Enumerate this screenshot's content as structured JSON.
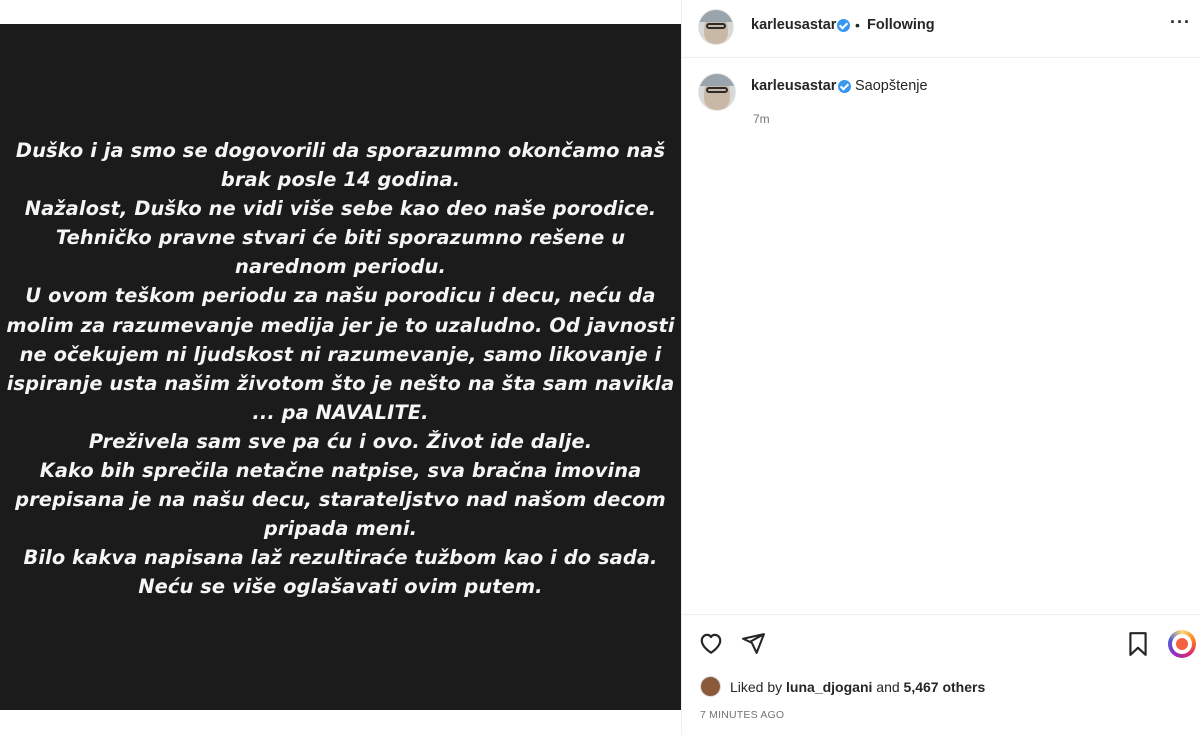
{
  "media": {
    "lines": [
      "Duško i ja smo se dogovorili da sporazumno okončamo naš",
      "brak posle 14 godina.",
      "Nažalost, Duško ne vidi više sebe kao deo naše porodice.",
      "Tehničko pravne stvari će biti sporazumno rešene u",
      "narednom periodu.",
      "U ovom teškom periodu za našu porodicu i decu, neću da",
      "molim za razumevanje medija jer je to uzaludno. Od javnosti",
      "ne očekujem ni ljudskost ni razumevanje, samo likovanje i",
      "ispiranje usta našim životom što je nešto na šta sam navikla",
      "... pa NAVALITE.",
      "Preživela sam sve pa ću i ovo. Život ide dalje.",
      "Kako bih sprečila netačne natpise, sva bračna imovina",
      "prepisana je na našu decu, starateljstvo nad našom decom",
      "pripada meni.",
      "Bilo kakva napisana laž rezultiraće tužbom kao i do sada.",
      "Neću se više oglašavati ovim putem."
    ]
  },
  "header": {
    "username": "karleusastar",
    "separator": "•",
    "follow_status": "Following",
    "more": "···"
  },
  "caption": {
    "username": "karleusastar",
    "text": "Saopštenje",
    "age": "7m"
  },
  "likes": {
    "prefix": "Liked by",
    "user": "luna_djogani",
    "and": "and",
    "others": "5,467 others"
  },
  "timestamp": "7 MINUTES AGO",
  "icons": {
    "verified": "verified-badge-icon",
    "like": "heart-icon",
    "share": "send-icon",
    "save": "bookmark-icon",
    "gift": "gift-icon"
  },
  "colors": {
    "media_bg": "#1b1b1b",
    "verified": "#3897f0",
    "muted": "#737373"
  }
}
